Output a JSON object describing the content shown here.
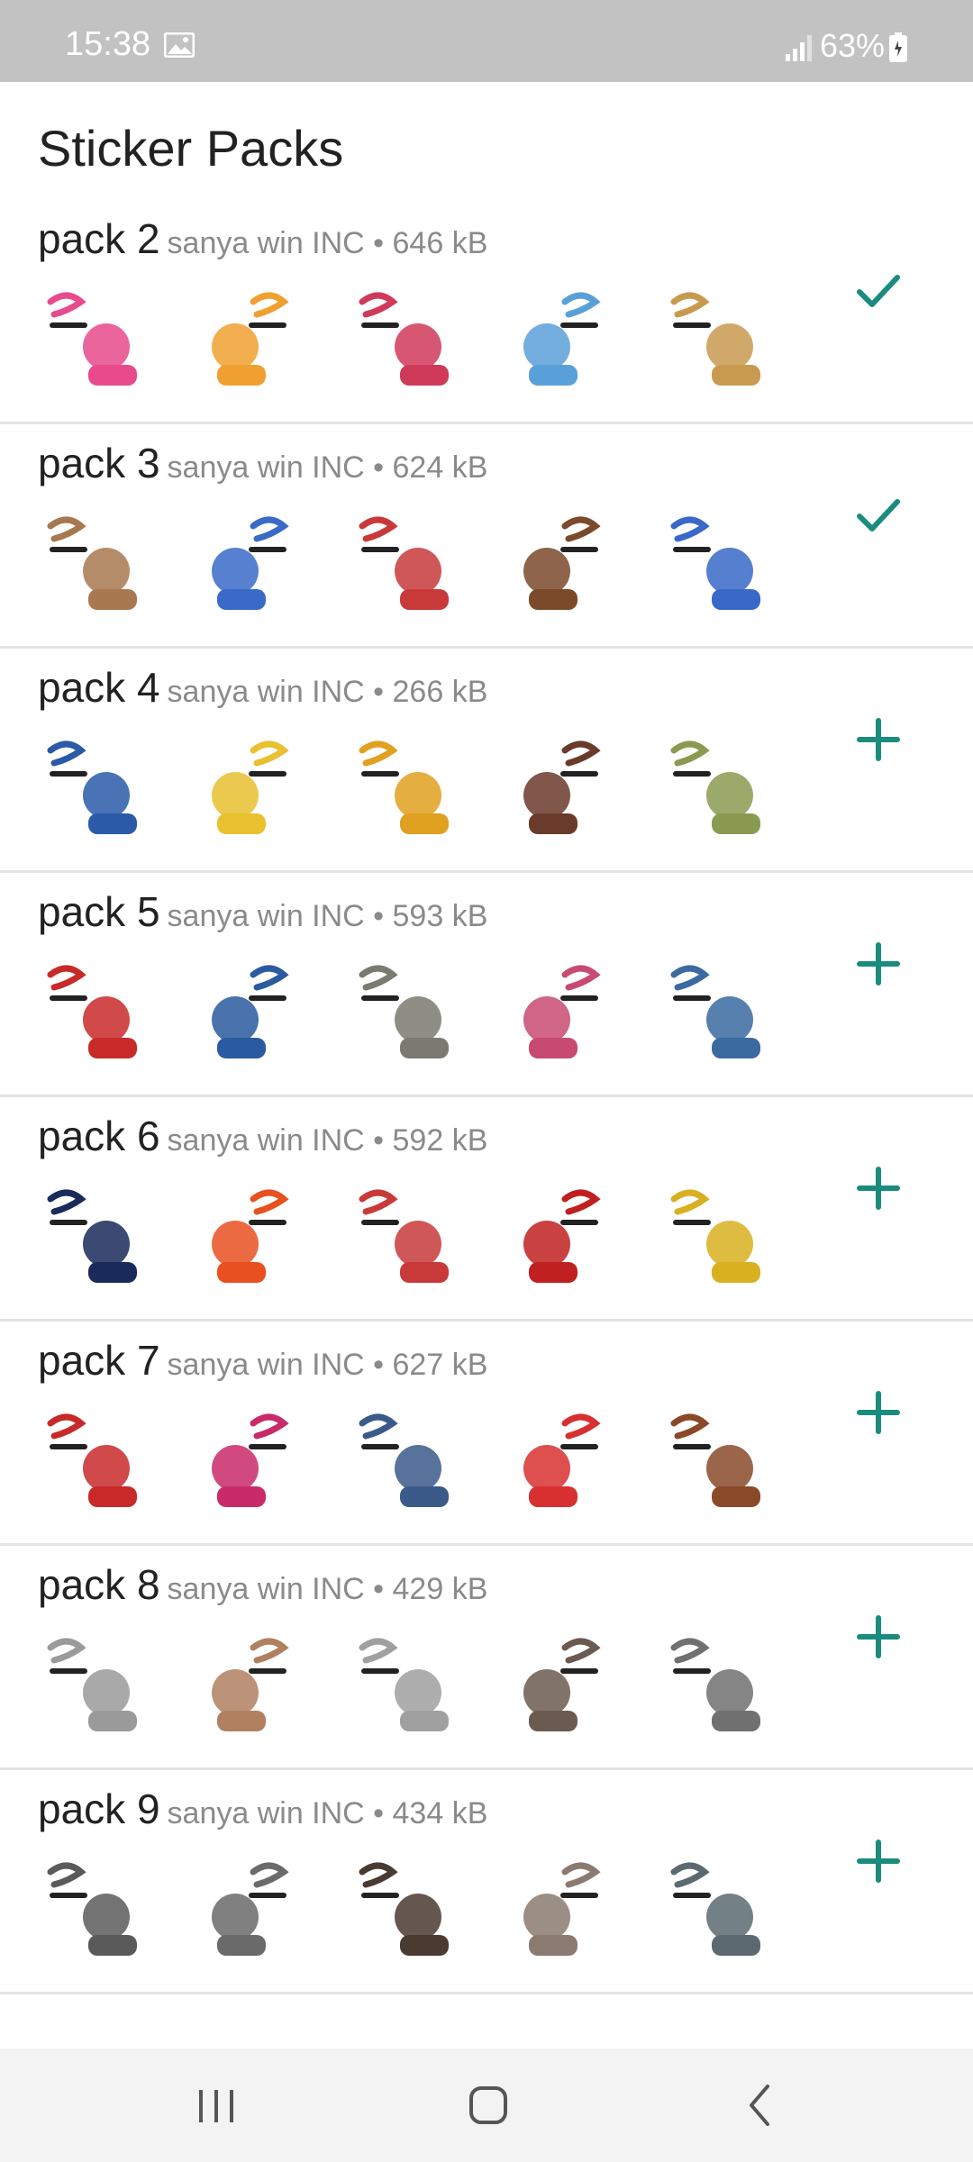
{
  "status_bar": {
    "time": "15:38",
    "battery": "63%"
  },
  "title": "Sticker Packs",
  "colors": {
    "accent": "#1a8c7e",
    "status_bar": "#c2c2c2"
  },
  "packs": [
    {
      "name": "pack 2",
      "meta": "sanya win INC • 646 kB",
      "added": true
    },
    {
      "name": "pack 3",
      "meta": "sanya win INC • 624 kB",
      "added": true
    },
    {
      "name": "pack 4",
      "meta": "sanya win INC • 266 kB",
      "added": false
    },
    {
      "name": "pack 5",
      "meta": "sanya win INC • 593 kB",
      "added": false
    },
    {
      "name": "pack 6",
      "meta": "sanya win INC • 592 kB",
      "added": false
    },
    {
      "name": "pack 7",
      "meta": "sanya win INC • 627 kB",
      "added": false
    },
    {
      "name": "pack 8",
      "meta": "sanya win INC • 429 kB",
      "added": false
    },
    {
      "name": "pack 9",
      "meta": "sanya win INC • 434 kB",
      "added": false
    }
  ],
  "icons": {
    "added": "check-icon",
    "not_added": "plus-icon",
    "nav": [
      "recent-apps-icon",
      "home-icon",
      "back-icon"
    ]
  }
}
